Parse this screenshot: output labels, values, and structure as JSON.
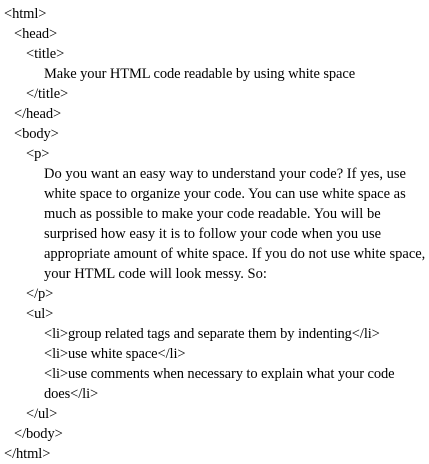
{
  "lines": {
    "html_open": "<html>",
    "head_open": "<head>",
    "title_open": "<title>",
    "title_text": "Make your HTML code readable by using white space",
    "title_close": "</title>",
    "head_close": "</head>",
    "body_open": "<body>",
    "p_open": "<p>",
    "paragraph": "Do you want an easy way to understand your code? If yes, use white space to organize your code. You can use white space as much as possible to make your code readable. You will be surprised how easy it is to follow your code when you use appropriate amount of white space. If you do not use white space, your HTML code will look messy. So:",
    "p_close": "</p>",
    "ul_open": "<ul>",
    "li_1": "<li>group related tags and separate them by indenting</li>",
    "li_2": "<li>use white space</li>",
    "li_3_a": "<li>use comments when necessary to explain what your code",
    "li_3_b": "does</li>",
    "ul_close": "</ul>",
    "body_close": "</body>",
    "html_close": "</html>"
  }
}
